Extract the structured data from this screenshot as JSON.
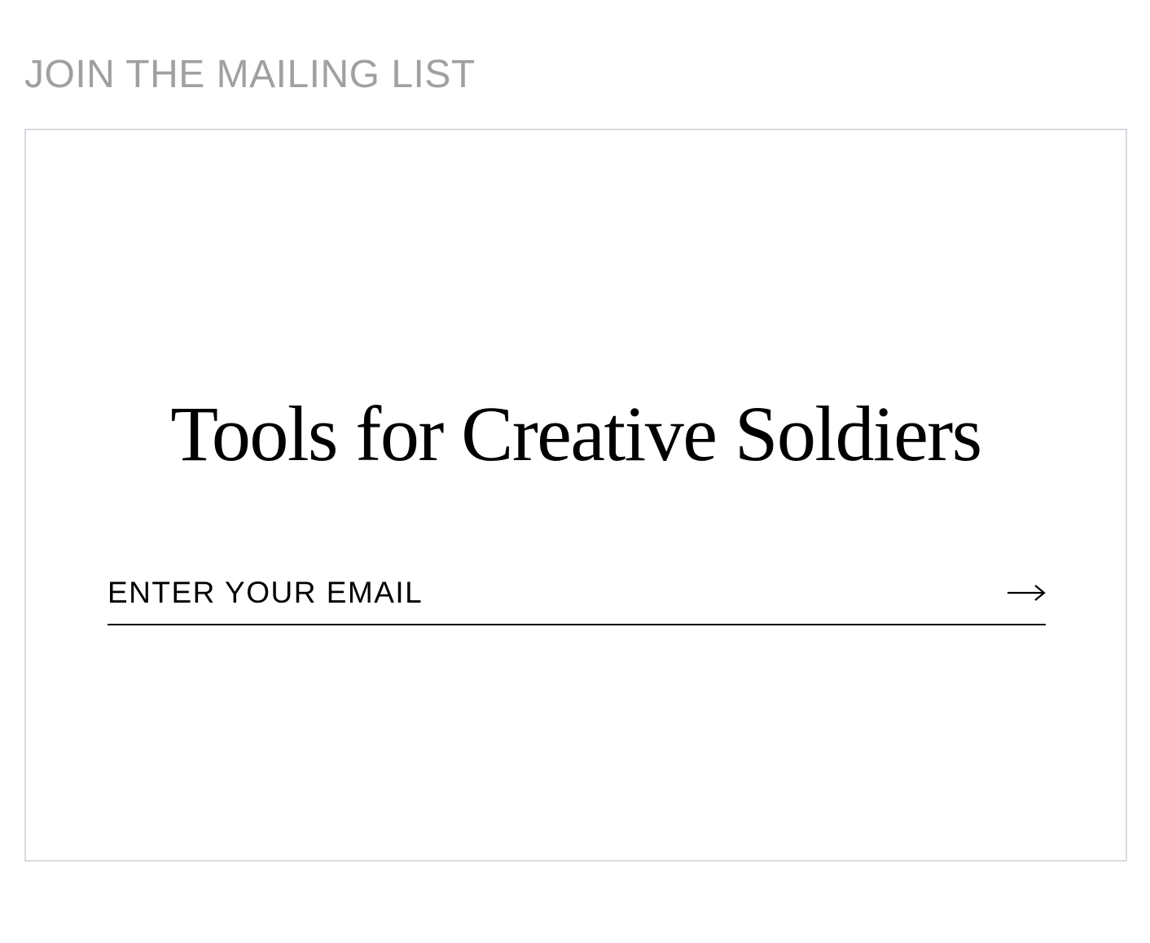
{
  "section": {
    "heading": "JOIN THE MAILING LIST"
  },
  "card": {
    "title": "Tools for Creative Soldiers",
    "email": {
      "placeholder": "ENTER YOUR EMAIL",
      "value": ""
    },
    "submit": {
      "icon": "arrow-right-icon",
      "aria_label": "Submit"
    }
  },
  "colors": {
    "heading_text": "#a0a0a2",
    "card_border": "#d9dae0",
    "title_text": "#000000",
    "underline": "#000000",
    "background": "#ffffff"
  }
}
